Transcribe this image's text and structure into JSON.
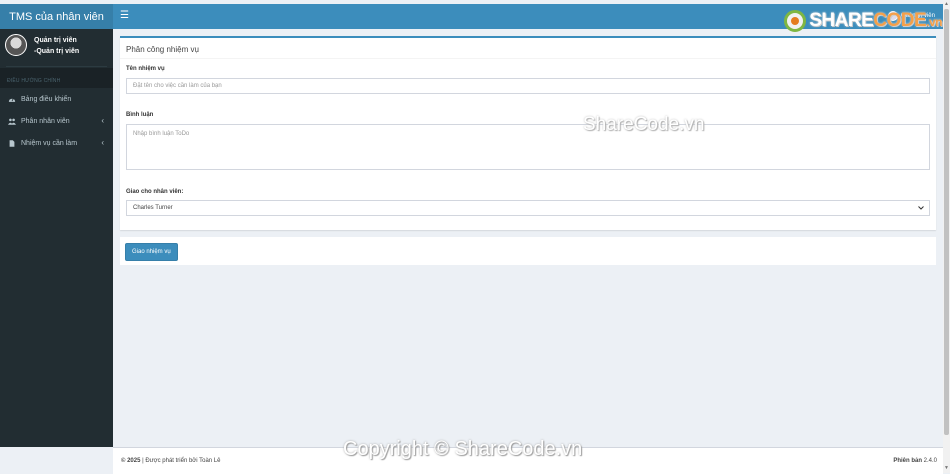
{
  "header": {
    "brand": "TMS của nhân viên",
    "menu_icon": "hamburger-icon",
    "user_label": "Quản trị viên"
  },
  "sidebar": {
    "user_name": "Quản trị viên",
    "user_role": "-Quản trị viên",
    "section_header": "ĐIỀU HƯỚNG CHÍNH",
    "items": [
      {
        "label": "Bảng điều khiển",
        "icon": "dashboard-icon"
      },
      {
        "label": "Phân nhân viên",
        "icon": "users-icon"
      },
      {
        "label": "Nhiệm vụ cần làm",
        "icon": "file-icon"
      }
    ]
  },
  "form": {
    "title": "Phân công nhiệm vụ",
    "task_name_label": "Tên nhiệm vụ",
    "task_name_placeholder": "Đặt tên cho việc cần làm của bạn",
    "comment_label": "Bình luận",
    "comment_placeholder": "Nhập bình luận ToDo",
    "assign_label": "Giao cho nhân viên:",
    "assign_selected": "Charles Turner",
    "submit_label": "Giao nhiệm vụ"
  },
  "footer": {
    "year": "© 2025",
    "credit": " | Được phát triển bởi Toàn Lê",
    "version_label": "Phiên bản",
    "version": " 2.4.0"
  },
  "watermarks": {
    "logo_prefix": "SHARE",
    "logo_suffix": "CODE",
    "logo_tld": ".vn",
    "center": "ShareCode.vn",
    "bottom": "Copyright © ShareCode.vn"
  },
  "colors": {
    "primary": "#3c8dbc",
    "sidebar": "#222d32",
    "background": "#ecf0f5"
  }
}
